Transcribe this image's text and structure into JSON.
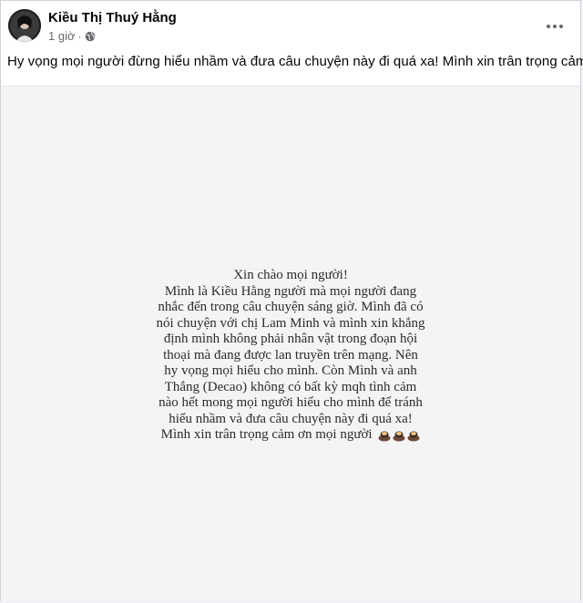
{
  "post": {
    "author": "Kiều Thị Thuý Hằng",
    "time": "1 giờ",
    "separator": "·",
    "privacy_icon": "globe-icon",
    "more_icon": "more-horizontal-icon",
    "caption": "Hy vọng mọi người đừng hiểu nhầm và đưa câu chuyện này đi quá xa! Mình xin trân trọng cảm ơn"
  },
  "image": {
    "lines": [
      "Xin chào mọi người!",
      "Mình là Kiều Hằng người mà mọi người đang",
      "nhắc đến trong câu chuyện sáng giờ. Mình đã có",
      "nói chuyện với chị Lam Minh và mình xin khẳng",
      "định mình không phải nhân vật trong đoạn hội",
      "thoại mà đang được lan truyền trên mạng. Nên",
      "hy vọng mọi hiểu cho mình. Còn Mình và anh",
      "Thắng (Decao) không có bất kỳ mqh tình cảm",
      "nào hết mong mọi người hiểu cho mình để tránh",
      "hiểu nhầm và đưa câu chuyện này đi quá xa!",
      "Mình xin trân trọng cảm ơn mọi người"
    ],
    "emoji_icon": "bowing-person-icon",
    "emoji_count": 3
  },
  "colors": {
    "text_primary": "#050505",
    "text_secondary": "#65676b",
    "image_background": "#f4f4f4"
  }
}
